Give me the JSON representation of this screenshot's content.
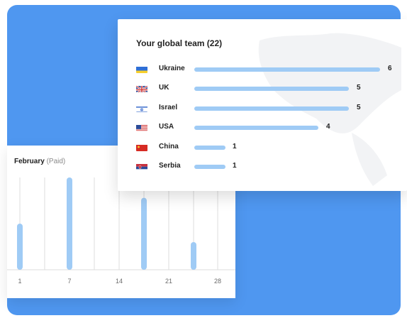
{
  "colors": {
    "panel": "#4f97f0",
    "bar": "#9fcbf5",
    "gridline": "#dcdcdc"
  },
  "team": {
    "title": "Your global team (22)",
    "countries": [
      {
        "name": "Ukraine",
        "count": 6,
        "flag": "ukraine-flag-icon"
      },
      {
        "name": "UK",
        "count": 5,
        "flag": "uk-flag-icon"
      },
      {
        "name": "Israel",
        "count": 5,
        "flag": "israel-flag-icon"
      },
      {
        "name": "USA",
        "count": 4,
        "flag": "usa-flag-icon"
      },
      {
        "name": "China",
        "count": 1,
        "flag": "china-flag-icon"
      },
      {
        "name": "Serbia",
        "count": 1,
        "flag": "serbia-flag-icon"
      }
    ]
  },
  "february": {
    "title": "February",
    "subtitle": "(Paid)"
  },
  "chart_data": {
    "type": "bar",
    "x": [
      1,
      7,
      18,
      24
    ],
    "values": [
      0.5,
      1.0,
      0.78,
      0.3
    ],
    "xticks": [
      "1",
      "7",
      "14",
      "21",
      "28"
    ],
    "xlim": [
      0,
      28
    ],
    "ylim": [
      0,
      1
    ],
    "grid": true
  }
}
